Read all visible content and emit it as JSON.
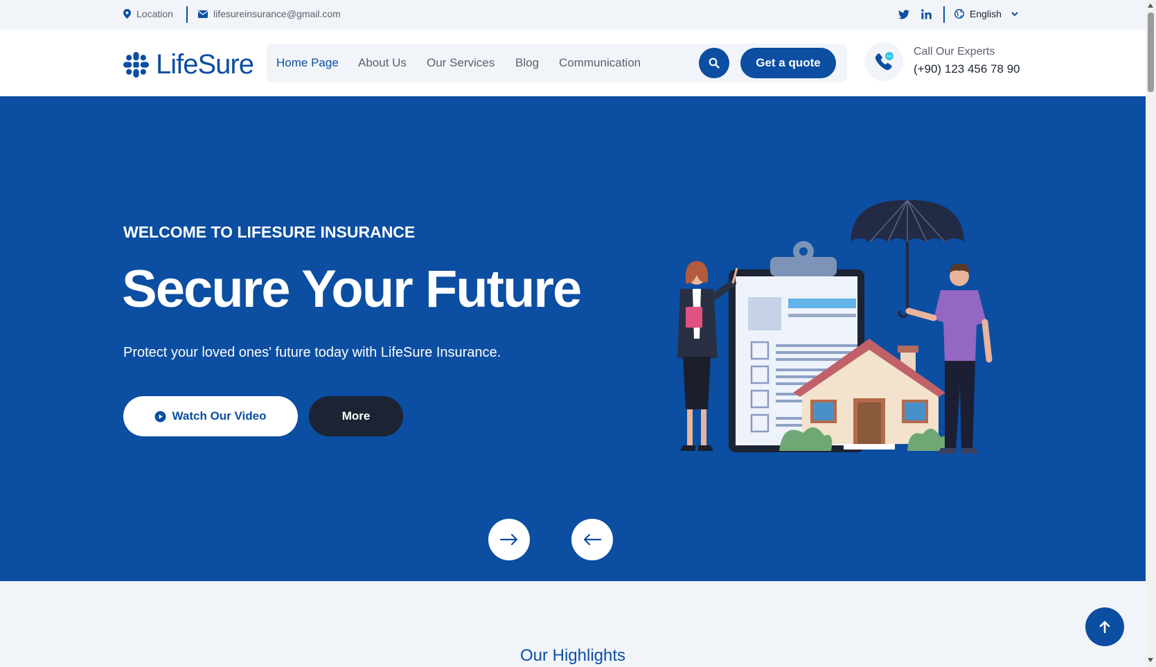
{
  "topbar": {
    "location": "Location",
    "email": "lifesureinsurance@gmail.com",
    "language": "English"
  },
  "brand": {
    "name": "LifeSure"
  },
  "nav": {
    "items": [
      {
        "label": "Home Page"
      },
      {
        "label": "About Us"
      },
      {
        "label": "Our Services"
      },
      {
        "label": "Blog"
      },
      {
        "label": "Communication"
      }
    ],
    "quote_label": "Get a quote",
    "call_label": "Call Our Experts",
    "call_number": "(+90) 123 456 78 90"
  },
  "hero": {
    "kicker": "WELCOME TO LIFESURE INSURANCE",
    "headline": "Secure Your Future",
    "subtext": "Protect your loved ones' future today with LifeSure Insurance.",
    "video_label": "Watch Our Video",
    "more_label": "More"
  },
  "section": {
    "title": "Our Highlights"
  },
  "colors": {
    "primary": "#0b4ea2",
    "dark": "#1c2333",
    "light_bg": "#f1f4f9"
  },
  "icons": [
    "map-pin-icon",
    "envelope-icon",
    "twitter-icon",
    "linkedin-icon",
    "globe-icon",
    "chevron-down-icon",
    "search-icon",
    "phone-icon",
    "play-icon",
    "arrow-right-icon",
    "arrow-left-icon",
    "arrow-up-icon"
  ]
}
